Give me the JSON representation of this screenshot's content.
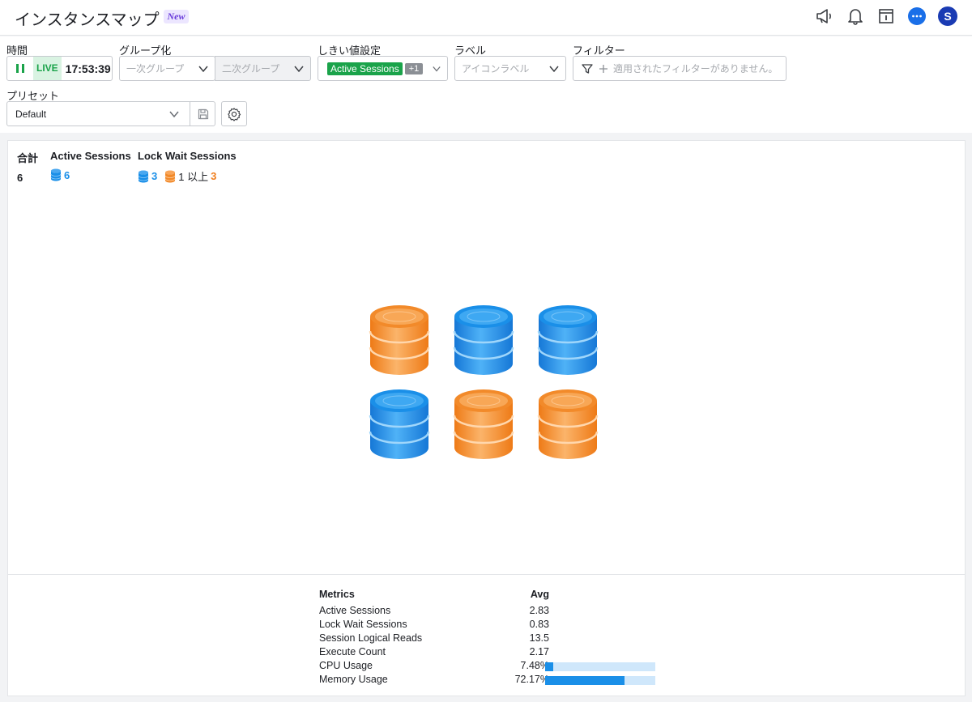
{
  "header": {
    "title": "インスタンスマップ",
    "badge": "New"
  },
  "toolbar": {
    "time": {
      "label": "時間",
      "live": "LIVE",
      "clock": "17:53:39"
    },
    "grouping": {
      "label": "グループ化",
      "primary_placeholder": "一次グループ",
      "secondary_placeholder": "二次グループ"
    },
    "threshold": {
      "label": "しきい値設定",
      "selected": "Active Sessions",
      "more": "+1"
    },
    "labels": {
      "label": "ラベル",
      "placeholder": "アイコンラベル"
    },
    "filter": {
      "label": "フィルター",
      "placeholder": "適用されたフィルターがありません。"
    },
    "preset": {
      "label": "プリセット",
      "value": "Default"
    }
  },
  "summary": {
    "total": {
      "label": "合計",
      "value": "6"
    },
    "active": {
      "label": "Active Sessions",
      "value": "6"
    },
    "lockwait": {
      "label": "Lock Wait Sessions",
      "blue_value": "3",
      "threshold_text": "1 以上",
      "orange_value": "3"
    }
  },
  "instances": {
    "colors": {
      "blue": "#1a8fe8",
      "orange": "#f28a2a"
    },
    "items": [
      {
        "status": "orange"
      },
      {
        "status": "blue"
      },
      {
        "status": "blue"
      },
      {
        "status": "blue"
      },
      {
        "status": "orange"
      },
      {
        "status": "orange"
      }
    ]
  },
  "metrics": {
    "header_name": "Metrics",
    "header_avg": "Avg",
    "rows": [
      {
        "name": "Active Sessions",
        "avg": "2.83"
      },
      {
        "name": "Lock Wait Sessions",
        "avg": "0.83"
      },
      {
        "name": "Session Logical Reads",
        "avg": "13.5"
      },
      {
        "name": "Execute Count",
        "avg": "2.17"
      },
      {
        "name": "CPU Usage",
        "avg": "7.48%",
        "percent": 7.48
      },
      {
        "name": "Memory Usage",
        "avg": "72.17%",
        "percent": 72.17
      }
    ]
  }
}
